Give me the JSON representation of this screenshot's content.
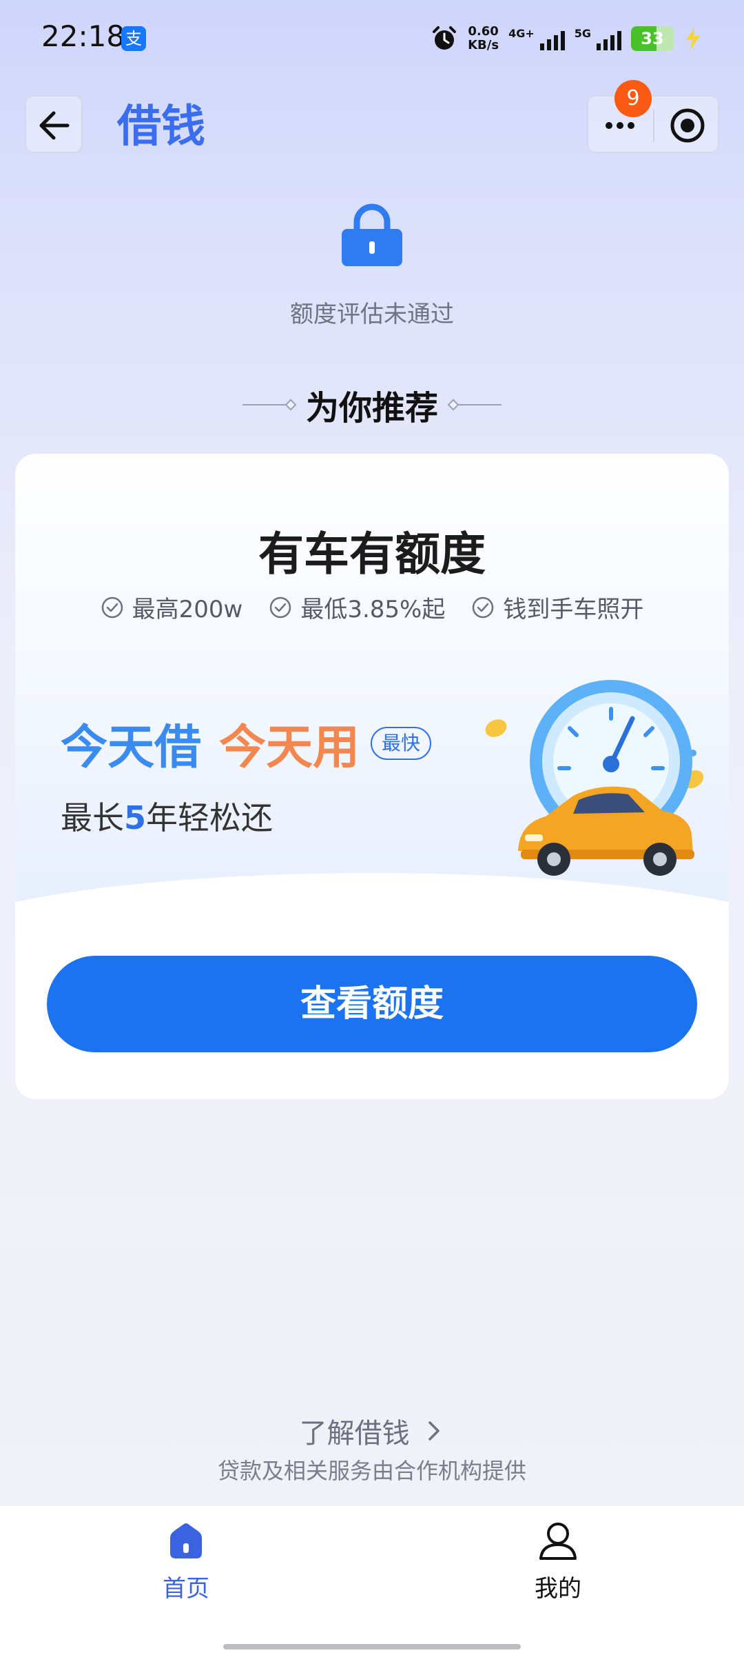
{
  "status_bar": {
    "time": "22:18",
    "app_badge": "支",
    "net_speed_value": "0.60",
    "net_speed_unit": "KB/s",
    "signal_1_label": "4G+",
    "signal_2_label": "5G",
    "battery": "33",
    "icons": [
      "alarm-icon",
      "signal-icon",
      "battery-icon",
      "charging-icon"
    ]
  },
  "header": {
    "title": "借钱",
    "notification_count": "9",
    "back_icon": "arrow-left-icon",
    "more_icon": "more-dots-icon",
    "close_icon": "target-icon"
  },
  "status": {
    "text": "额度评估未通过",
    "icon": "lock-icon"
  },
  "section": {
    "title": "为你推荐"
  },
  "card": {
    "title": "有车有额度",
    "features": [
      "最高200w",
      "最低3.85%起",
      "钱到手车照开"
    ],
    "slogan_blue": "今天借",
    "slogan_orange": "今天用",
    "tag": "最快",
    "subline_prefix": "最长",
    "subline_number": "5",
    "subline_suffix": "年轻松还",
    "cta": "查看额度",
    "illustration": "speedometer-car-illustration"
  },
  "footer": {
    "learn_more": "了解借钱",
    "provider": "贷款及相关服务由合作机构提供"
  },
  "tabbar": {
    "items": [
      {
        "label": "首页",
        "icon": "home-icon",
        "active": true
      },
      {
        "label": "我的",
        "icon": "user-icon",
        "active": false
      }
    ]
  },
  "colors": {
    "brand_blue": "#1b73ef",
    "title_blue": "#3b6df0",
    "accent_orange": "#f2874f",
    "badge_orange": "#fa5a14"
  }
}
